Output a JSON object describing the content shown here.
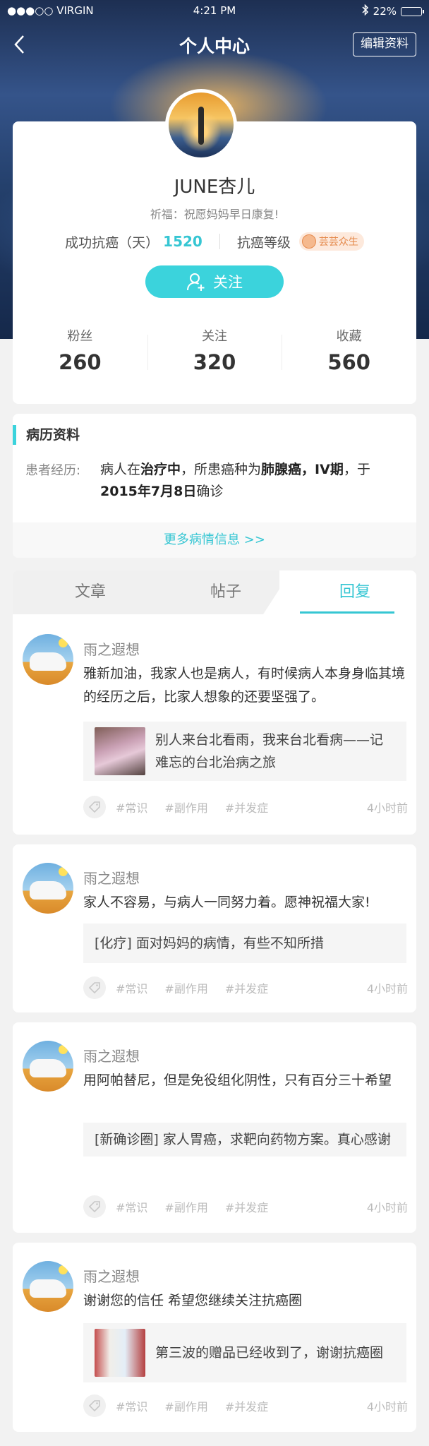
{
  "status_bar": {
    "carrier": "●●●○○ VIRGIN",
    "time": "4:21 PM",
    "battery": "22%",
    "battery_level": 0.22
  },
  "nav": {
    "back": "‹",
    "title": "个人中心",
    "edit": "编辑资料"
  },
  "profile": {
    "username": "JUNE杏儿",
    "blessing": "祈福：祝愿妈妈早日康复!",
    "days_label": "成功抗癌（天）",
    "days_value": "1520",
    "level_label": "抗癌等级",
    "level_badge": "芸芸众生",
    "follow_label": "关注",
    "counts": [
      {
        "label": "粉丝",
        "value": "260"
      },
      {
        "label": "关注",
        "value": "320"
      },
      {
        "label": "收藏",
        "value": "560"
      }
    ]
  },
  "history": {
    "title": "病历资料",
    "label": "患者经历:",
    "t1": "病人在",
    "status": "治疗中",
    "t2": "，所患癌种为",
    "cancer": "肺腺癌，IV期",
    "t3": "，于",
    "date": "2015年7月8日",
    "t4": "确诊",
    "more": "更多病情信息 >>"
  },
  "tabs": {
    "articles": "文章",
    "posts": "帖子",
    "replies": "回复"
  },
  "posts": [
    {
      "name": "雨之遐想",
      "text": "雅新加油，我家人也是病人，有时候病人本身身临其境的经历之后，比家人想象的还要坚强了。",
      "quote": "别人来台北看雨，我来台北看病——记难忘的台北治病之旅",
      "tags": [
        "#常识",
        "#副作用",
        "#并发症"
      ],
      "time": "4小时前"
    },
    {
      "name": "雨之遐想",
      "text": "家人不容易，与病人一同努力着。愿神祝福大家!",
      "quote": "[化疗] 面对妈妈的病情，有些不知所措",
      "tags": [
        "#常识",
        "#副作用",
        "#并发症"
      ],
      "time": "4小时前"
    },
    {
      "name": "雨之遐想",
      "text": "用阿帕替尼，但是免役组化阴性，只有百分三十希望",
      "quote": "[新确诊圈] 家人胃癌，求靶向药物方案。真心感谢",
      "tags": [
        "#常识",
        "#副作用",
        "#并发症"
      ],
      "time": "4小时前"
    },
    {
      "name": "雨之遐想",
      "text": "谢谢您的信任 希望您继续关注抗癌圈",
      "quote": "第三波的赠品已经收到了，谢谢抗癌圈",
      "tags": [
        "#常识",
        "#副作用",
        "#并发症"
      ],
      "time": "4小时前"
    }
  ]
}
